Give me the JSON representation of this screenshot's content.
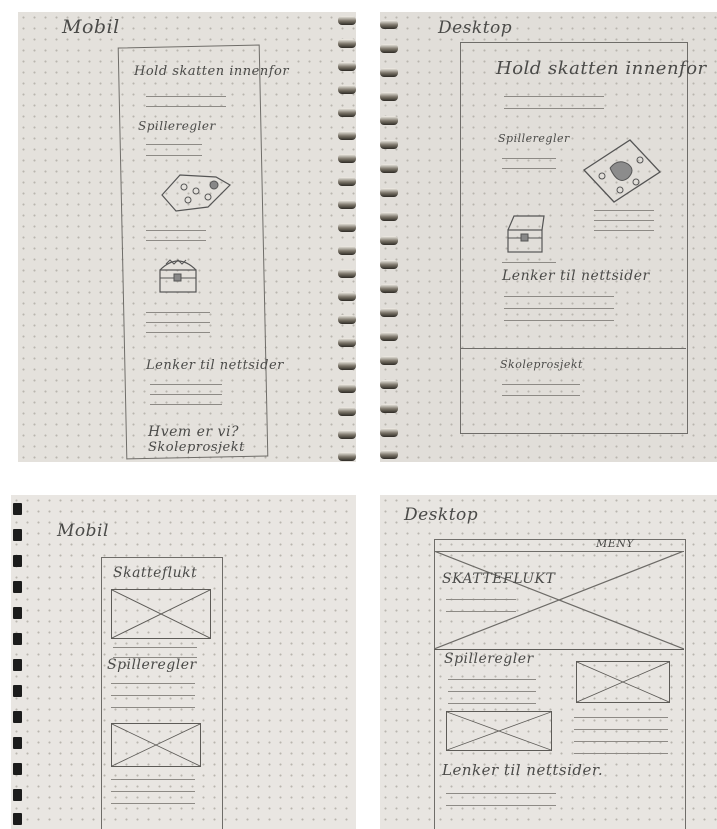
{
  "panels": [
    {
      "heading": "Mobil",
      "title": "Hold skatten innenfor",
      "rules": "Spilleregler",
      "links": "Lenker til nettsider",
      "about": "Hvem er vi?",
      "project": "Skoleprosjekt",
      "icons": [
        "treasure-map-icon",
        "treasure-chest-icon"
      ]
    },
    {
      "heading": "Desktop",
      "title": "Hold skatten innenfor",
      "rules": "Spilleregler",
      "links": "Lenker til nettsider",
      "project": "Skoleprosjekt",
      "icons": [
        "treasure-map-icon",
        "treasure-chest-icon"
      ]
    },
    {
      "heading": "Mobil",
      "title": "Skatteflukt",
      "rules": "Spilleregler",
      "icons": [
        "image-placeholder-icon"
      ]
    },
    {
      "heading": "Desktop",
      "menu": "MENY",
      "title": "SKATTEFLUKT",
      "rules": "Spilleregler",
      "links": "Lenker til nettsider.",
      "icons": [
        "image-placeholder-icon"
      ]
    }
  ],
  "colors": {
    "paper": "#e6e3de",
    "pencil": "#4a4a48",
    "spiral": "#7a7468"
  }
}
